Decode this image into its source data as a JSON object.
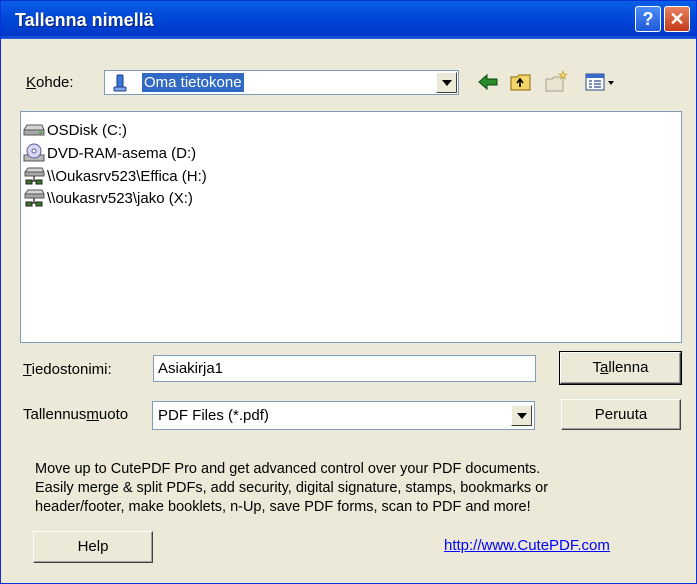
{
  "window": {
    "title": "Tallenna nimellä",
    "help_glyph": "?",
    "close_glyph": "✕"
  },
  "lookin": {
    "label": "Kohde:",
    "label_accel": "K",
    "label_rest": "ohde:",
    "value": "Oma tietokone",
    "icon": "my-computer-icon"
  },
  "toolbar": {
    "back_icon": "back-arrow-icon",
    "up_icon": "up-folder-icon",
    "new_folder_icon": "new-folder-icon",
    "views_icon": "views-menu-icon"
  },
  "files": [
    {
      "label": "OSDisk (C:)",
      "icon": "hard-disk-icon"
    },
    {
      "label": "DVD-RAM-asema (D:)",
      "icon": "dvd-drive-icon"
    },
    {
      "label": "\\\\Oukasrv523\\Effica (H:)",
      "icon": "network-drive-icon"
    },
    {
      "label": "\\\\oukasrv523\\jako (X:)",
      "icon": "network-drive-icon"
    }
  ],
  "filename": {
    "label_accel": "T",
    "label_rest": "iedostonimi:",
    "value": "Asiakirja1"
  },
  "filetype": {
    "label_pre": "Tallennus",
    "label_accel": "m",
    "label_rest": "uoto",
    "value": "PDF Files (*.pdf)"
  },
  "buttons": {
    "save_pre": "T",
    "save_accel": "a",
    "save_rest": "llenna",
    "cancel": "Peruuta",
    "help": "Help"
  },
  "promo": {
    "line1": "Move up to CutePDF Pro and get advanced control over your PDF documents.",
    "line2": "Easily merge & split PDFs, add security, digital signature, stamps, bookmarks or",
    "line3": "header/footer, make booklets, n-Up, save PDF forms, scan to PDF and more!"
  },
  "link": {
    "url_text": "http://www.CutePDF.com"
  },
  "colors": {
    "titlebar": "#0047d8",
    "face": "#ece9d8",
    "selection": "#316ac5",
    "link": "#0000ff"
  }
}
